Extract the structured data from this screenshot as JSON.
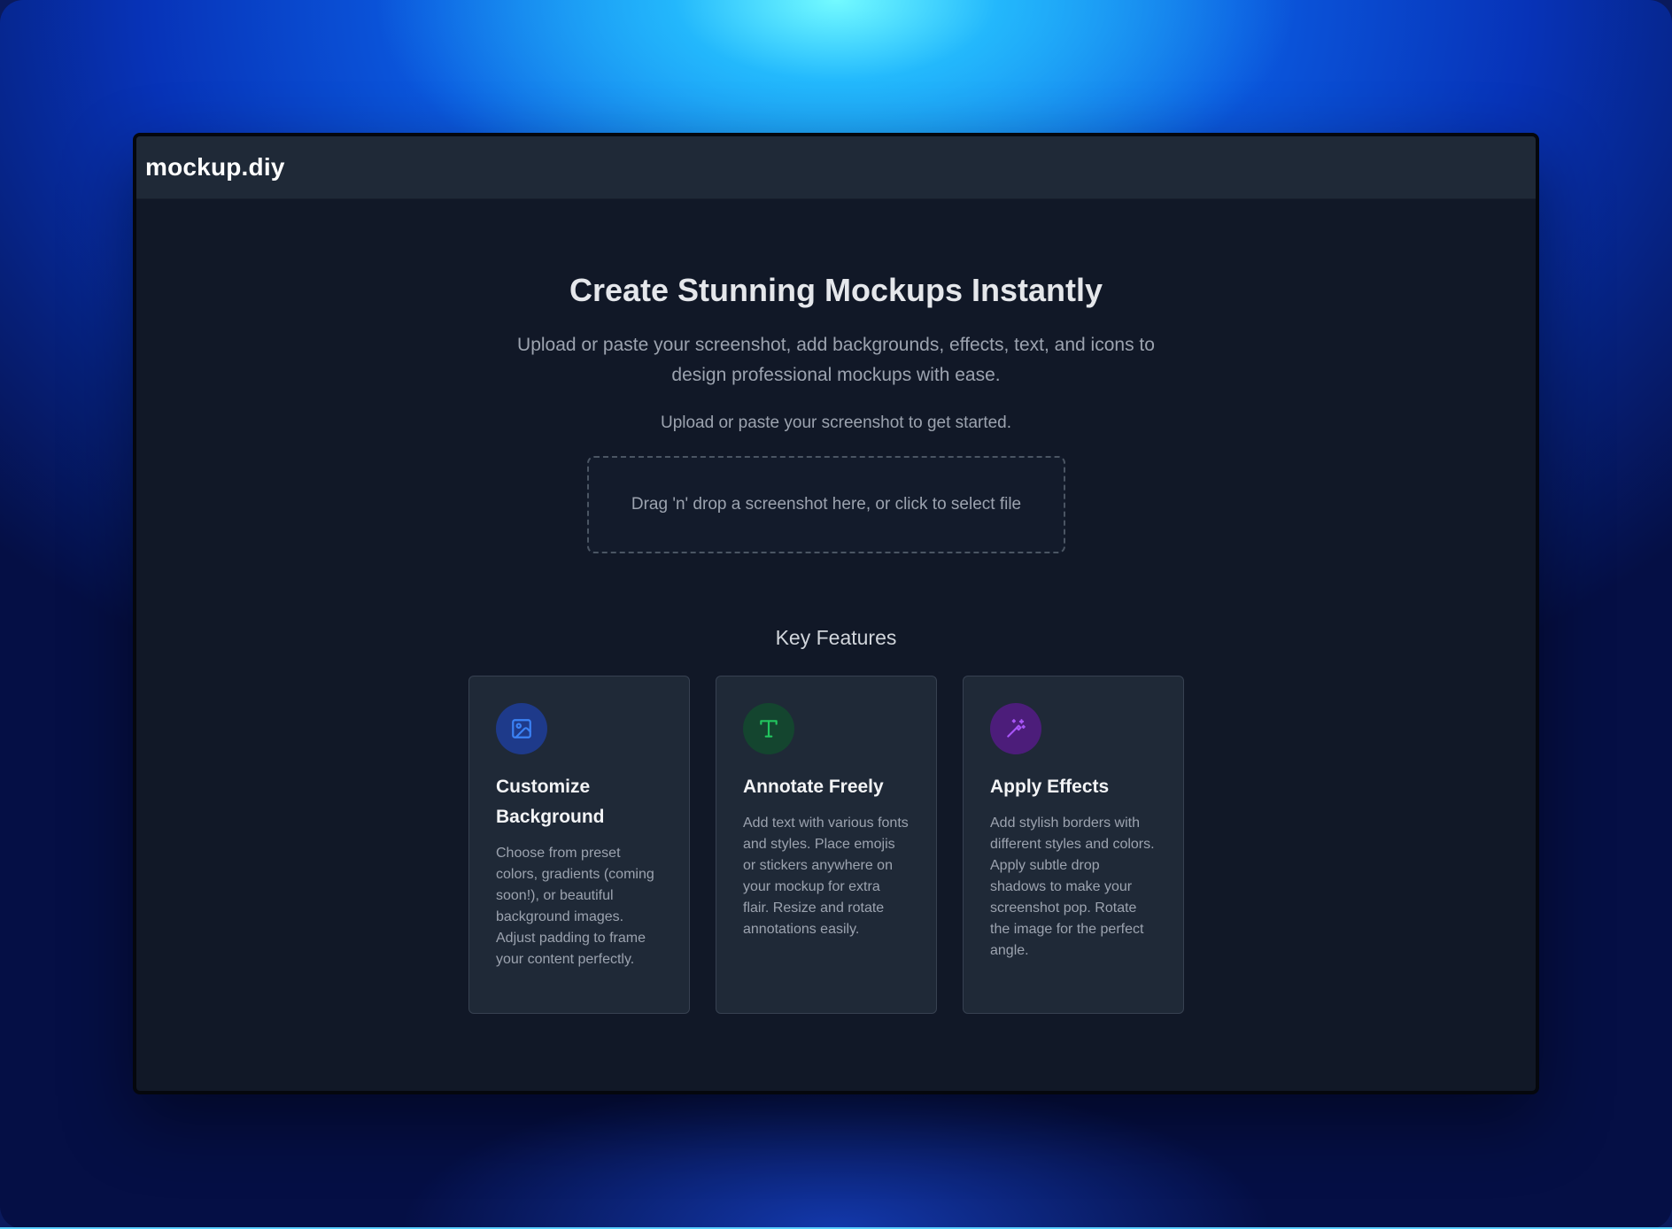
{
  "app": {
    "brand": "mockup.diy"
  },
  "hero": {
    "title": "Create Stunning Mockups Instantly",
    "subtitle": "Upload or paste your screenshot, add backgrounds, effects, text, and icons to design professional mockups with ease."
  },
  "upload": {
    "hint": "Upload or paste your screenshot to get started.",
    "dropzone_label": "Drag 'n' drop a screenshot here, or click to select file"
  },
  "features": {
    "heading": "Key Features",
    "items": [
      {
        "icon": "image-icon",
        "accent": "#3b82f6",
        "title": "Customize Background",
        "description": "Choose from preset colors, gradients (coming soon!), or beautiful background images. Adjust padding to frame your content perfectly."
      },
      {
        "icon": "text-type-icon",
        "accent": "#22c55e",
        "title": "Annotate Freely",
        "description": "Add text with various fonts and styles. Place emojis or stickers anywhere on your mockup for extra flair. Resize and rotate annotations easily."
      },
      {
        "icon": "magic-wand-icon",
        "accent": "#a855f7",
        "title": "Apply Effects",
        "description": "Add stylish borders with different styles and colors. Apply subtle drop shadows to make your screenshot pop. Rotate the image for the perfect angle."
      }
    ]
  }
}
